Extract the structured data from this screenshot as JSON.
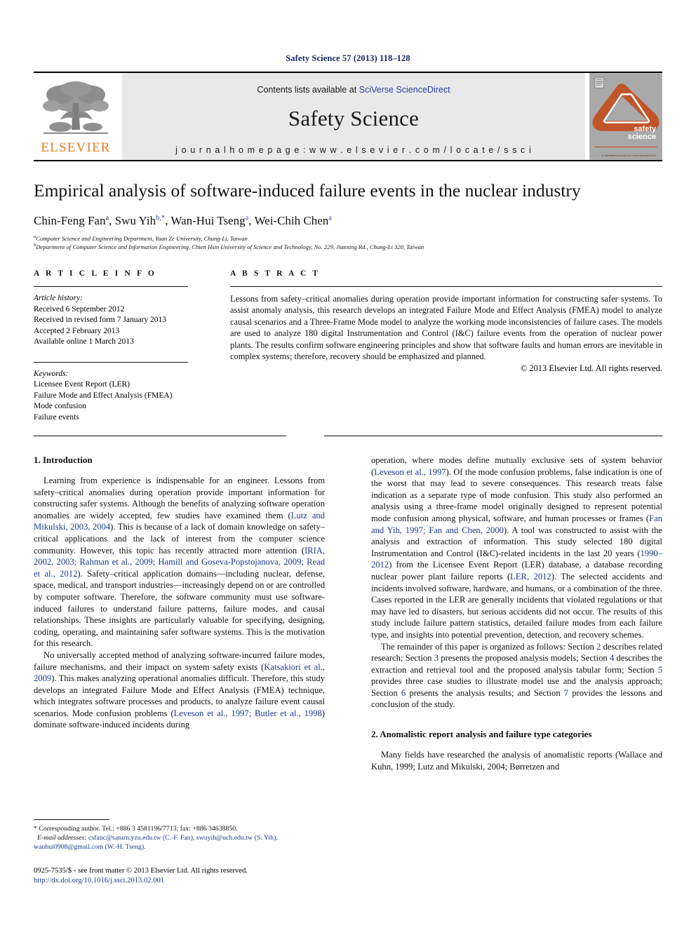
{
  "running_head": "Safety Science 57 (2013) 118–128",
  "masthead": {
    "publisher_name": "ELSEVIER",
    "contents_prefix": "Contents lists available at ",
    "contents_link": "SciVerse ScienceDirect",
    "journal_title": "Safety Science",
    "homepage_line": "j o u r n a l  h o m e p a g e :  w w w . e l s e v i e r . c o m / l o c a t e / s s c i",
    "cover_label_line1": "safety",
    "cover_label_line2": "science",
    "cover_foot": "An International Journal of\nIn Honor Advanced Work",
    "accent_orange": "#ec7b21",
    "cover_orange": "#c0552a",
    "link_blue": "#2b3fa0",
    "band_gray": "#e9e9e9"
  },
  "title": "Empirical analysis of software-induced failure events in the nuclear industry",
  "authors_plain": "Chin-Feng Fan a, Swu Yih b,*, Wan-Hui Tseng a, Wei-Chih Chen a",
  "authors": [
    {
      "name": "Chin-Feng Fan",
      "marks": "a"
    },
    {
      "name": "Swu Yih",
      "marks": "b,*"
    },
    {
      "name": "Wan-Hui Tseng",
      "marks": "a"
    },
    {
      "name": "Wei-Chih Chen",
      "marks": "a"
    }
  ],
  "affiliations": [
    {
      "mark": "a",
      "text": "Computer Science and Engineering Department, Yuan Ze University, Chung-Li, Taiwan"
    },
    {
      "mark": "b",
      "text": "Department of Computer Science and Information Engineering, Chien Hsin University of Science and Technology, No. 229, Jianxing Rd., Chung-Li 320, Taiwan"
    }
  ],
  "article_info": {
    "heading": "A R T I C L E   I N F O",
    "history_label": "Article history:",
    "history": [
      "Received 6 September 2012",
      "Received in revised form 7 January 2013",
      "Accepted 2 February 2013",
      "Available online 1 March 2013"
    ],
    "keywords_label": "Keywords:",
    "keywords": [
      "Licensee Event Report (LER)",
      "Failure Mode and Effect Analysis (FMEA)",
      "Mode confusion",
      "Failure events"
    ]
  },
  "abstract": {
    "heading": "A B S T R A C T",
    "text": "Lessons from safety–critical anomalies during operation provide important information for constructing safer systems. To assist anomaly analysis, this research develops an integrated Failure Mode and Effect Analysis (FMEA) model to analyze causal scenarios and a Three-Frame Mode model to analyze the working mode inconsistencies of failure cases. The models are used to analyze 180 digital Instrumentation and Control (I&C) failure events from the operation of nuclear power plants. The results confirm software engineering principles and show that software faults and human errors are inevitable in complex systems; therefore, recovery should be emphasized and planned.",
    "copyright": "© 2013 Elsevier Ltd. All rights reserved."
  },
  "body": {
    "section1_title": "1. Introduction",
    "section1_p1": "Learning from experience is indispensable for an engineer. Lessons from safety–critical anomalies during operation provide important information for constructing safer systems. Although the benefits of analyzing software operation anomalies are widely accepted, few studies have examined them (Lutz and Mikulski, 2003, 2004). This is because of a lack of domain knowledge on safety–critical applications and the lack of interest from the computer science community. However, this topic has recently attracted more attention (IRIA, 2002, 2003; Rahman et al., 2009; Hamill and Goseva-Popstojanova, 2009; Read et al., 2012). Safety–critical application domains—including nuclear, defense, space, medical, and transport industries—increasingly depend on or are controlled by computer software. Therefore, the software community must use software-induced failures to understand failure patterns, failure modes, and causal relationships. These insights are particularly valuable for specifying, designing, coding, operating, and maintaining safer software systems. This is the motivation for this research.",
    "section1_p2": "No universally accepted method of analyzing software-incurred failure modes, failure mechanisms, and their impact on system safety exists (Katsakiori et al., 2009). This makes analyzing operational anomalies difficult. Therefore, this study develops an integrated Failure Mode and Effect Analysis (FMEA) technique, which integrates software processes and products, to analyze failure event causal scenarios. Mode confusion problems (Leveson et al., 1997; Butler et al., 1998) dominate software-induced incidents during",
    "section1_p3": "operation, where modes define mutually exclusive sets of system behavior (Leveson et al., 1997). Of the mode confusion problems, false indication is one of the worst that may lead to severe consequences. This research treats false indication as a separate type of mode confusion. This study also performed an analysis using a three-frame model originally designed to represent potential mode confusion among physical, software, and human processes or frames (Fan and Yih, 1997; Fan and Chen, 2000). A tool was constructed to assist with the analysis and extraction of information. This study selected 180 digital Instrumentation and Control (I&C)-related incidents in the last 20 years (1990–2012) from the Licensee Event Report (LER) database, a database recording nuclear power plant failure reports (LER, 2012). The selected accidents and incidents involved software, hardware, and humans, or a combination of the three. Cases reported in the LER are generally incidents that violated regulations or that may have led to disasters, but serious accidents did not occur. The results of this study include failure pattern statistics, detailed failure modes from each failure type, and insights into potential prevention, detection, and recovery schemes.",
    "section1_p4": "The remainder of this paper is organized as follows: Section 2 describes related research; Section 3 presents the proposed analysis models; Section 4 describes the extraction and retrieval tool and the proposed analysis tabular form; Section 5 provides three case studies to illustrate model use and the analysis approach; Section 6 presents the analysis results; and Section 7 provides the lessons and conclusion of the study.",
    "section2_title": "2. Anomalistic report analysis and failure type categories",
    "section2_p1": "Many fields have researched the analysis of anomalistic reports (Wallace and Kuhn, 1999; Lutz and Mikulski, 2004; Børretzen and"
  },
  "footnote": {
    "corresponding": "* Corresponding author. Tel.: +886 3 4581196/7713; fax: +886 34638850.",
    "email_label": "E-mail addresses:",
    "email_text": " csfanc@saturn.yzu.edu.tw (C.-F. Fan), swuyih@uch.edu.tw (S. Yih), wanhui0908@gmail.com (W.-H. Tseng)."
  },
  "issn": {
    "line1": "0925-7535/$ - see front matter © 2013 Elsevier Ltd. All rights reserved.",
    "doi": "http://dx.doi.org/10.1016/j.ssci.2013.02.001"
  }
}
